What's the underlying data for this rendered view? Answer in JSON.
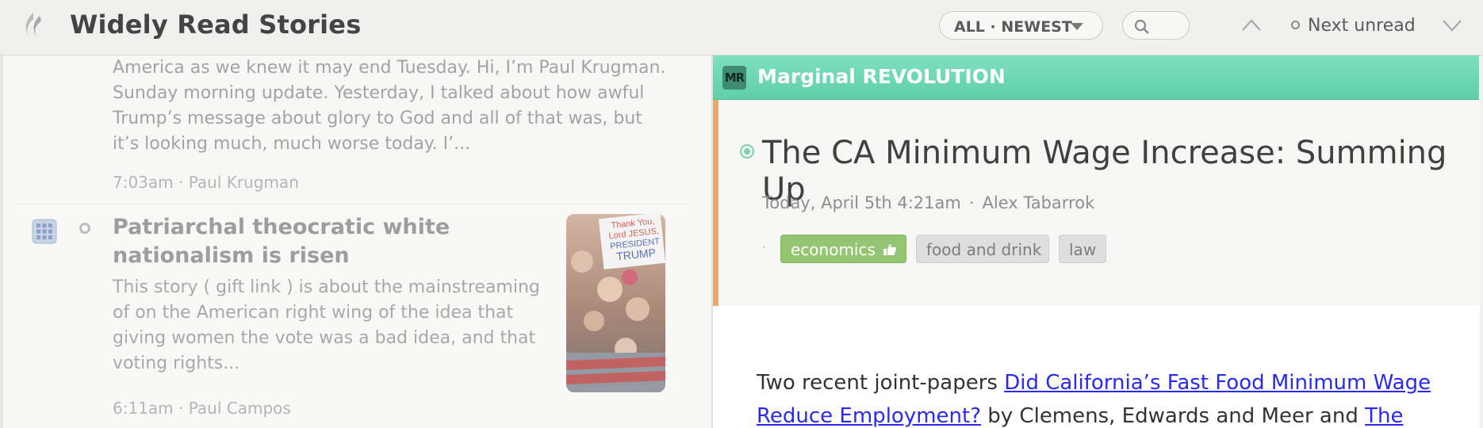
{
  "header": {
    "title": "Widely Read Stories",
    "filter_label": "ALL · NEWEST",
    "next_unread_label": "Next unread"
  },
  "stories": [
    {
      "snippet": "America as we knew it may end Tuesday. Hi, I’m Paul Krugman. Sunday morning update. Yesterday, I talked about how awful Trump’s message about glory to God and all of that was, but it’s looking much, much worse today. I’...",
      "time": "7:03am",
      "author": "Paul Krugman"
    },
    {
      "headline": "Patriarchal theocratic white nationalism is risen",
      "snippet": "This story ( gift link ) is about the mainstreaming of on the American right wing of the idea that giving women the vote was a bad idea, and that voting rights...",
      "time": "6:11am",
      "author": "Paul Campos",
      "thumbnail_sign": [
        "Thank You,",
        "Lord JESUS,",
        "PRESIDENT",
        "TRUMP"
      ]
    }
  ],
  "reader": {
    "feed_name": "Marginal REVOLUTION",
    "feed_favicon": "MR",
    "story_title": "The CA Minimum Wage Increase: Summing Up",
    "date": "Today, April 5th 4:21am",
    "author": "Alex Tabarrok",
    "tag_lead": "·",
    "tags": [
      "economics",
      "food and drink",
      "law"
    ],
    "body_prefix": "Two recent joint-papers ",
    "body_link1": "Did California’s Fast Food Minimum Wage Reduce Employment?",
    "body_middle": " by Clemens, Edwards and Meer and ",
    "body_link2": "The"
  },
  "colors": {
    "feed_bar": "#6ad7b3",
    "story_accent": "#efa765",
    "tag_positive": "#94c572",
    "link": "#2a2aee"
  }
}
